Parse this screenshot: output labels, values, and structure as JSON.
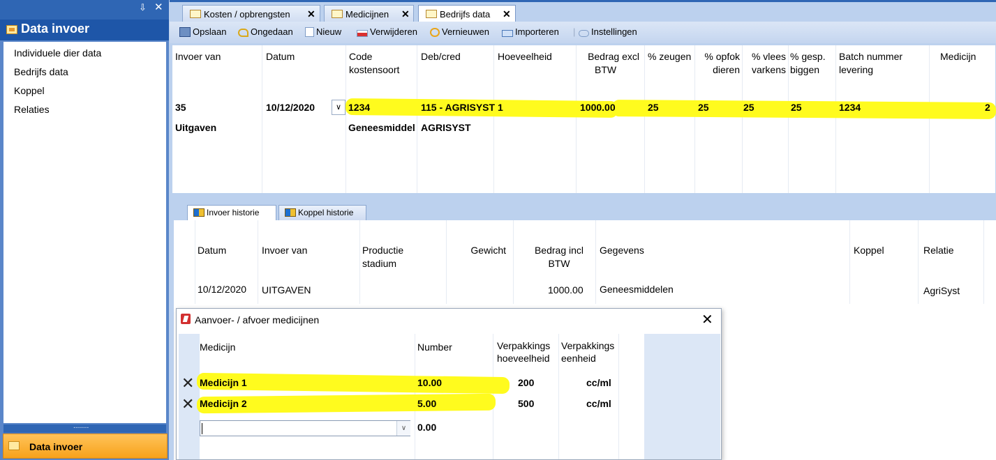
{
  "left_panel": {
    "pin_glyph": "⇩",
    "close_glyph": "✕",
    "header_title": "Data invoer",
    "items": [
      "Individuele dier data",
      "Bedrijfs data",
      "Koppel",
      "Relaties"
    ],
    "grip_dots": "........",
    "bottom_button": "Data invoer"
  },
  "tabs": [
    {
      "label": "Kosten / opbrengsten",
      "close": "✕"
    },
    {
      "label": "Medicijnen",
      "close": "✕"
    },
    {
      "label": "Bedrijfs data",
      "close": "✕"
    }
  ],
  "toolbar": {
    "save": "Opslaan",
    "undo": "Ongedaan",
    "new": "Nieuw",
    "delete": "Verwijderen",
    "refresh": "Vernieuwen",
    "import": "Importeren",
    "settings": "Instellingen"
  },
  "main_grid": {
    "headers": {
      "invoer_van": "Invoer van",
      "datum": "Datum",
      "code_1": "Code",
      "code_2": "kostensoort",
      "debcred": "Deb/cred",
      "hoeveelheid": "Hoeveelheid",
      "bedrag_1": "Bedrag excl",
      "bedrag_2": "BTW",
      "zeugen": "% zeugen",
      "opfok_1": "% opfok",
      "opfok_2": "dieren",
      "vlees_1": "% vlees",
      "vlees_2": "varkens",
      "gesp_1": "% gesp.",
      "gesp_2": "biggen",
      "batch_1": "Batch nummer",
      "batch_2": "levering",
      "medicijn": "Medicijn"
    },
    "row1": {
      "invoer_van": "35",
      "datum": "10/12/2020",
      "dropdown": "∨",
      "code": "1234",
      "debcred": "115 - AGRISYST",
      "hoeveelheid": "1",
      "bedrag": "1000.00",
      "zeugen": "25",
      "opfok": "25",
      "vlees": "25",
      "gesp": "25",
      "batch": "1234",
      "medicijn": "2"
    },
    "row2": {
      "invoer_van": "Uitgaven",
      "code": "Geneesmiddel",
      "debcred": "AGRISYST"
    }
  },
  "sub_tabs": [
    "Invoer historie",
    "Koppel historie"
  ],
  "history": {
    "headers": {
      "datum": "Datum",
      "invoer_van": "Invoer van",
      "productie_1": "Productie",
      "productie_2": "stadium",
      "gewicht": "Gewicht",
      "bedrag_1": "Bedrag incl",
      "bedrag_2": "BTW",
      "gegevens": "Gegevens",
      "koppel": "Koppel",
      "relatie": "Relatie"
    },
    "row": {
      "datum": "10/12/2020",
      "invoer_van": "UITGAVEN",
      "bedrag": "1000.00",
      "gegevens": "Geneesmiddelen",
      "relatie": "AgriSyst"
    }
  },
  "dialog": {
    "title": "Aanvoer- / afvoer medicijnen",
    "close": "✕",
    "headers": {
      "medicijn": "Medicijn",
      "number": "Number",
      "verp_hoev_1": "Verpakkings",
      "verp_hoev_2": "hoeveelheid",
      "verp_eenh_1": "Verpakkings",
      "verp_eenh_2": "eenheid"
    },
    "rows": [
      {
        "medicijn": "Medicijn 1",
        "number": "10.00",
        "hoeveelheid": "200",
        "eenheid": "cc/ml"
      },
      {
        "medicijn": "Medicijn 2",
        "number": "5.00",
        "hoeveelheid": "500",
        "eenheid": "cc/ml"
      }
    ],
    "delete_glyph": "✕",
    "new_row_number": "0.00",
    "new_row_dropdown": "∨"
  },
  "colors": {
    "highlight": "#fffb1e",
    "panel_blue": "#2f66b4",
    "accent_orange": "#f7a21b"
  }
}
